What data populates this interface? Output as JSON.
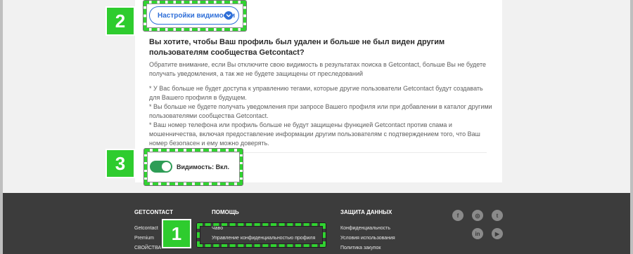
{
  "visibility_button": {
    "label": "Настройки видимости",
    "icon": "chevron-down-circle-icon"
  },
  "content": {
    "title": "Вы хотите, чтобы Ваш профиль был удален и больше не был виден другим пользователям сообщества Getcontact?",
    "intro": "Обратите внимание, если Вы отключите свою видимость в результатах поиска в Getcontact, больше Вы не будете получать уведомления, а так же не будете защищены от преследований",
    "bullets": [
      "* У Вас больше не будет доступа к управлению тегами, которые другие пользователи Getcontact будут создавать для Вашего профиля в будущем.",
      "* Вы больше не будете получать уведомления при запросе Вашего профиля или при добавлении в каталог другими пользователями сообщества Getcontact.",
      "* Ваш номер телефона или профиль больше не будут защищены функцией Getcontact против спама и мошенничества, включая предоставление информации другим пользователям с подтверждением того, что Ваш номер безопасен и ему можно доверять."
    ]
  },
  "toggle": {
    "label": "Видимость: Вкл.",
    "state": "on",
    "color": "#2e9d56"
  },
  "footer": {
    "col1": {
      "heading": "GETCONTACT",
      "links": [
        "Getcontact",
        "Premium",
        "СВОЙСТВА"
      ]
    },
    "col2": {
      "heading": "ПОМОЩЬ",
      "links": [
        "Чаво",
        "Управление конфиденциальностью профиля"
      ]
    },
    "col3": {
      "heading": "ЗАЩИТА ДАННЫХ",
      "links": [
        "Конфиденциальность",
        "Условия использования",
        "Политика закупок"
      ]
    },
    "social": [
      {
        "icon": "facebook-icon",
        "glyph": "f"
      },
      {
        "icon": "instagram-icon",
        "glyph": "◎"
      },
      {
        "icon": "twitter-icon",
        "glyph": "t"
      },
      {
        "icon": "linkedin-icon",
        "glyph": "in"
      },
      {
        "icon": "youtube-icon",
        "glyph": "▶"
      }
    ]
  },
  "annotations": {
    "step1": "1",
    "step2": "2",
    "step3": "3",
    "color": "#2ecc2e"
  }
}
